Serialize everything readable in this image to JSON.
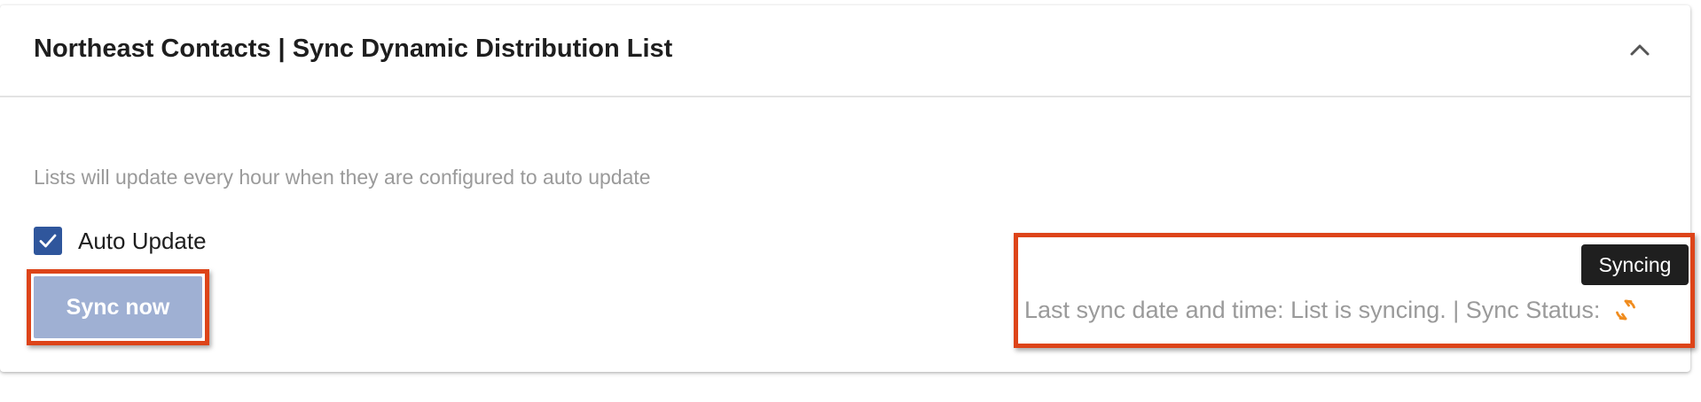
{
  "card": {
    "title": "Northeast Contacts | Sync Dynamic Distribution List",
    "collapse_icon": "chevron-up-icon"
  },
  "hint_text": "Lists will update every hour when they are configured to auto update",
  "auto_update": {
    "label": "Auto Update",
    "checked": true,
    "color": "#2f569c"
  },
  "sync_button": {
    "label": "Sync now",
    "color": "#9fb0d3"
  },
  "sync_status": {
    "text": "Last sync date and time: List is syncing. | Sync Status:",
    "icon": "sync-icon",
    "icon_color": "#f08c1e",
    "tooltip": "Syncing"
  },
  "colors": {
    "highlight": "#dd4419",
    "muted_text": "#9a9a9a",
    "title_text": "#1e1e1e"
  }
}
